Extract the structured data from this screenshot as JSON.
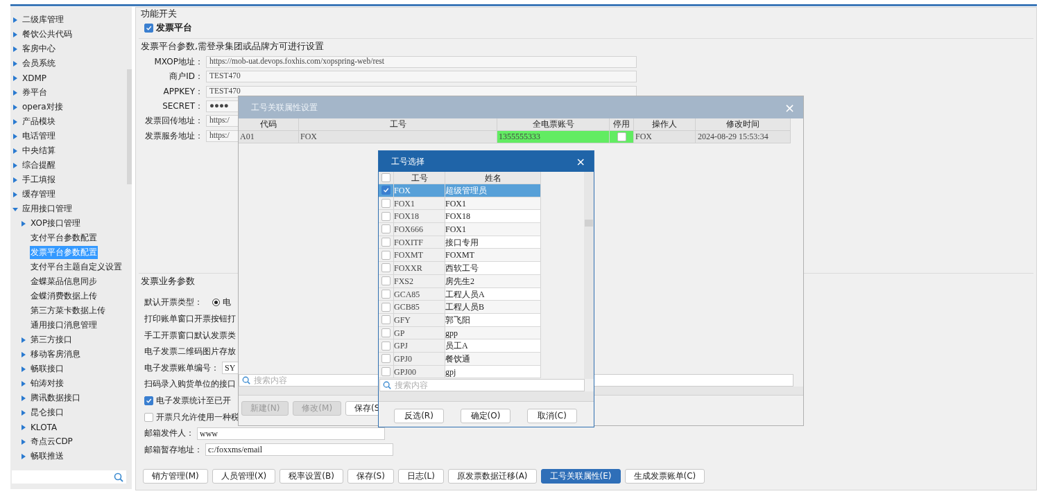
{
  "sidebar": {
    "items": [
      {
        "label": "二级库管理",
        "kind": "folder",
        "expanded": false,
        "selected": false
      },
      {
        "label": "餐饮公共代码",
        "kind": "folder",
        "expanded": false,
        "selected": false
      },
      {
        "label": "客房中心",
        "kind": "folder",
        "expanded": false,
        "selected": false
      },
      {
        "label": "会员系统",
        "kind": "folder",
        "expanded": false,
        "selected": false
      },
      {
        "label": "XDMP",
        "kind": "folder",
        "expanded": false,
        "selected": false
      },
      {
        "label": "券平台",
        "kind": "folder",
        "expanded": false,
        "selected": false
      },
      {
        "label": "opera对接",
        "kind": "folder",
        "expanded": false,
        "selected": false
      },
      {
        "label": "产品模块",
        "kind": "folder",
        "expanded": false,
        "selected": false
      },
      {
        "label": "电话管理",
        "kind": "folder",
        "expanded": false,
        "selected": false
      },
      {
        "label": "中央结算",
        "kind": "folder",
        "expanded": false,
        "selected": false
      },
      {
        "label": "综合提醒",
        "kind": "folder",
        "expanded": false,
        "selected": false
      },
      {
        "label": "手工填报",
        "kind": "folder",
        "expanded": false,
        "selected": false
      },
      {
        "label": "缓存管理",
        "kind": "folder",
        "expanded": false,
        "selected": false
      },
      {
        "label": "应用接口管理",
        "kind": "folder",
        "expanded": true,
        "selected": false,
        "children": [
          {
            "label": "XOP接口管理",
            "kind": "folder",
            "expanded": false,
            "selected": false
          },
          {
            "label": "支付平台参数配置",
            "kind": "leaf",
            "selected": false
          },
          {
            "label": "发票平台参数配置",
            "kind": "leaf",
            "selected": true
          },
          {
            "label": "支付平台主题自定义设置",
            "kind": "leaf",
            "selected": false
          },
          {
            "label": "金蝶菜品信息同步",
            "kind": "leaf",
            "selected": false
          },
          {
            "label": "金蝶消费数据上传",
            "kind": "leaf",
            "selected": false
          },
          {
            "label": "第三方菜卡数据上传",
            "kind": "leaf",
            "selected": false
          },
          {
            "label": "通用接口消息管理",
            "kind": "leaf",
            "selected": false
          },
          {
            "label": "第三方接口",
            "kind": "folder",
            "expanded": false,
            "selected": false
          },
          {
            "label": "移动客房消息",
            "kind": "folder",
            "expanded": false,
            "selected": false
          },
          {
            "label": "畅联接口",
            "kind": "folder",
            "expanded": false,
            "selected": false
          },
          {
            "label": "铂涛对接",
            "kind": "folder",
            "expanded": false,
            "selected": false
          },
          {
            "label": "腾讯数据接口",
            "kind": "folder",
            "expanded": false,
            "selected": false
          },
          {
            "label": "昆仑接口",
            "kind": "folder",
            "expanded": false,
            "selected": false
          },
          {
            "label": "KLOTA",
            "kind": "folder",
            "expanded": false,
            "selected": false
          },
          {
            "label": "奇点云CDP",
            "kind": "folder",
            "expanded": false,
            "selected": false
          },
          {
            "label": "畅联推送",
            "kind": "folder",
            "expanded": false,
            "selected": false
          }
        ]
      }
    ]
  },
  "feature_switch": {
    "title": "功能开关",
    "checkbox": {
      "label": "发票平台",
      "checked": true
    }
  },
  "platform_params": {
    "title": "发票平台参数,需登录集团或品牌方可进行设置",
    "fields": [
      {
        "label": "MXOP地址：",
        "value": "https://mob-uat.devops.foxhis.com/xopspring-web/rest"
      },
      {
        "label": "商户ID：",
        "value": "TEST470"
      },
      {
        "label": "APPKEY：",
        "value": "TEST470"
      },
      {
        "label": "SECRET：",
        "value": "●●●●"
      },
      {
        "label": "发票回传地址：",
        "value": "https:/"
      },
      {
        "label": "发票服务地址：",
        "value": "https:/"
      }
    ]
  },
  "business_params": {
    "title": "发票业务参数",
    "rows": [
      {
        "kind": "radio",
        "label": "默认开票类型：",
        "options": [
          {
            "label": "电",
            "selected": true
          }
        ]
      },
      {
        "kind": "text",
        "label": "打印账单窗口开票按钮打"
      },
      {
        "kind": "text",
        "label": "手工开票窗口默认发票类"
      },
      {
        "kind": "text",
        "label": "电子发票二维码图片存放"
      },
      {
        "kind": "field",
        "label": "电子发票账单编号：",
        "value": "SY"
      },
      {
        "kind": "text",
        "label": "扫码录入购货单位的接口"
      },
      {
        "kind": "checkbox",
        "label": "电子发票统计至已开",
        "checked": true
      },
      {
        "kind": "checkbox",
        "label": "开票只允许使用一种税",
        "checked": false
      },
      {
        "kind": "field",
        "label": "邮箱发件人：",
        "value": "www"
      },
      {
        "kind": "field",
        "label": "邮箱暂存地址：",
        "value": "c:/foxxms/email"
      }
    ]
  },
  "bottom_buttons": [
    {
      "label": "销方管理(M)",
      "selected": false
    },
    {
      "label": "人员管理(X)",
      "selected": false
    },
    {
      "label": "税率设置(B)",
      "selected": false
    },
    {
      "label": "保存(S)",
      "selected": false
    },
    {
      "label": "日志(L)",
      "selected": false
    },
    {
      "label": "原发票数据迁移(A)",
      "selected": false
    },
    {
      "label": "工号关联属性(E)",
      "selected": true
    },
    {
      "label": "生成发票账单(C)",
      "selected": false
    }
  ],
  "link_dialog": {
    "title": "工号关联属性设置",
    "close": "×",
    "columns": [
      "代码",
      "工号",
      "全电票账号",
      "停用",
      "操作人",
      "修改时间"
    ],
    "rows": [
      {
        "code": "A01",
        "staff_id": "FOX",
        "account": "1355555333",
        "disabled": false,
        "operator": "FOX",
        "modified": "2024-08-29 15:53:34"
      }
    ],
    "search": {
      "placeholder": "搜索内容"
    },
    "buttons": [
      {
        "label": "新建(N)",
        "disabled": true
      },
      {
        "label": "修改(M)",
        "disabled": true
      },
      {
        "label": "保存(S",
        "disabled": false
      }
    ]
  },
  "staff_dialog": {
    "title": "工号选择",
    "close": "×",
    "all_checked": false,
    "columns": [
      "工号",
      "姓名"
    ],
    "rows": [
      {
        "id": "FOX",
        "name": "超级管理员",
        "checked": true,
        "selected": true
      },
      {
        "id": "FOX1",
        "name": "FOX1",
        "checked": false,
        "selected": false
      },
      {
        "id": "FOX18",
        "name": "FOX18",
        "checked": false,
        "selected": false
      },
      {
        "id": "FOX666",
        "name": "FOX1",
        "checked": false,
        "selected": false
      },
      {
        "id": "FOXITF",
        "name": "接口专用",
        "checked": false,
        "selected": false
      },
      {
        "id": "FOXMT",
        "name": "FOXMT",
        "checked": false,
        "selected": false
      },
      {
        "id": "FOXXR",
        "name": "西软工号",
        "checked": false,
        "selected": false
      },
      {
        "id": "FXS2",
        "name": "房先生2",
        "checked": false,
        "selected": false
      },
      {
        "id": "GCA85",
        "name": "工程人员A",
        "checked": false,
        "selected": false
      },
      {
        "id": "GCB85",
        "name": "工程人员B",
        "checked": false,
        "selected": false
      },
      {
        "id": "GFY",
        "name": "郭飞阳",
        "checked": false,
        "selected": false
      },
      {
        "id": "GP",
        "name": "gpp",
        "checked": false,
        "selected": false
      },
      {
        "id": "GPJ",
        "name": "员工A",
        "checked": false,
        "selected": false
      },
      {
        "id": "GPJ0",
        "name": "餐饮通",
        "checked": false,
        "selected": false
      },
      {
        "id": "GPJ00",
        "name": "gpj",
        "checked": false,
        "selected": false
      }
    ],
    "search": {
      "placeholder": "搜索内容"
    },
    "buttons": [
      "反选(R)",
      "确定(O)",
      "取消(C)"
    ]
  }
}
